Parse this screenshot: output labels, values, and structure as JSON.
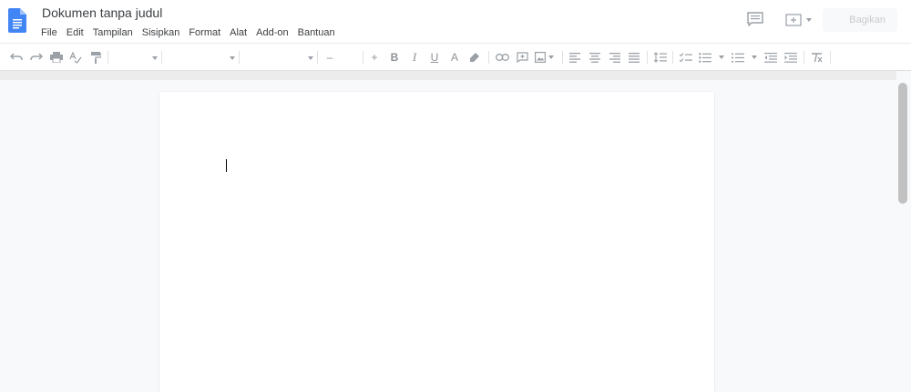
{
  "app": {
    "title": "Dokumen tanpa judul",
    "menu": [
      "File",
      "Edit",
      "Tampilan",
      "Sisipkan",
      "Format",
      "Alat",
      "Add-on",
      "Bantuan"
    ],
    "share_label": "Bagikan",
    "brand_color": "#4285f4"
  },
  "toolbar": {
    "items": [
      "undo-icon",
      "redo-icon",
      "print-icon",
      "spellcheck-icon",
      "paint-format-icon",
      "zoom-select",
      "style-select",
      "font-select",
      "font-size-decrease",
      "font-size-increase",
      "bold-icon",
      "italic-icon",
      "underline-icon",
      "text-color-icon",
      "highlight-icon",
      "link-icon",
      "comment-icon",
      "image-icon",
      "align-left-icon",
      "align-center-icon",
      "align-right-icon",
      "align-justify-icon",
      "line-spacing-icon",
      "checklist-icon",
      "bulleted-list-icon",
      "numbered-list-icon",
      "decrease-indent-icon",
      "increase-indent-icon",
      "clear-formatting-icon"
    ],
    "minus": "–",
    "plus": "+",
    "bold": "B",
    "italic": "I",
    "underline": "U",
    "text_color": "A"
  }
}
